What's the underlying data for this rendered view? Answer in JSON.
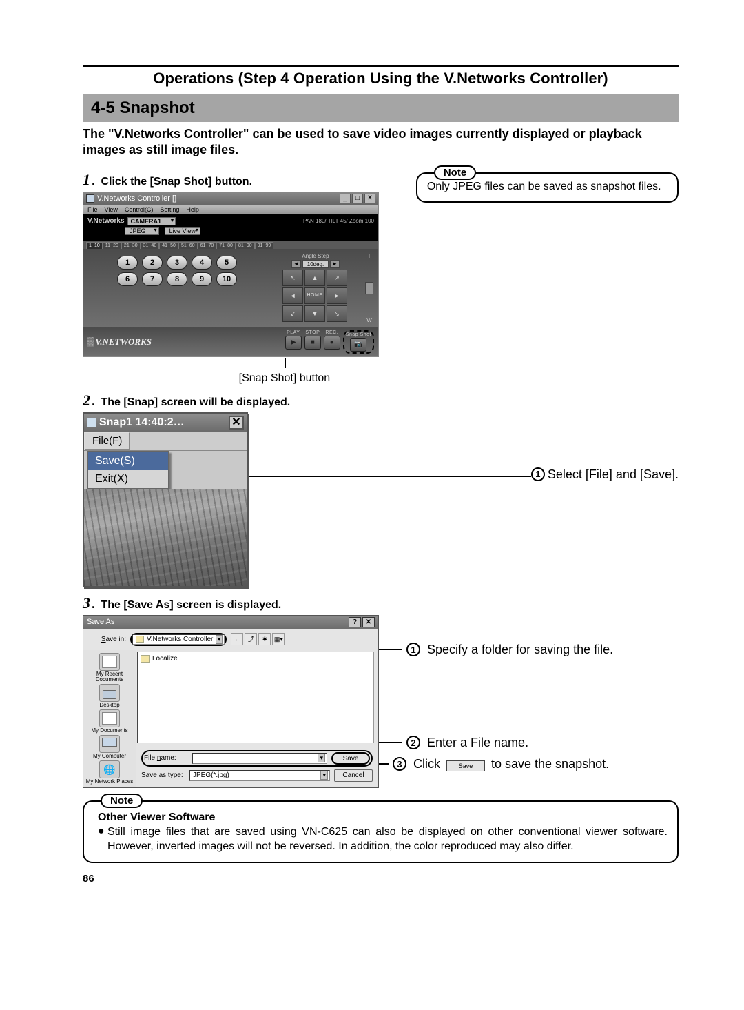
{
  "header": {
    "title": "Operations (Step 4 Operation Using the V.Networks Controller)"
  },
  "section": {
    "heading": "4-5 Snapshot",
    "intro": "The \"V.Networks Controller\" can be used to save video images currently displayed or playback images as still image files."
  },
  "note1": {
    "label": "Note",
    "body": "Only JPEG files can be saved as snapshot files."
  },
  "steps": {
    "s1": {
      "num": "1",
      "text": "Click the [Snap Shot] button."
    },
    "s2": {
      "num": "2",
      "text": "The [Snap] screen will be displayed."
    },
    "s3": {
      "num": "3",
      "text": "The [Save As] screen is displayed."
    }
  },
  "vn": {
    "title": "V.Networks Controller []",
    "menu": {
      "file": "File",
      "view": "View",
      "control": "Control(C)",
      "setting": "Setting",
      "help": "Help"
    },
    "brand": "V.Networks",
    "camera_label": "CAMERA1",
    "info": "PAN 180/ TILT 45/ Zoom 100",
    "jpeg": "JPEG",
    "live": "Live View",
    "tabs": [
      "1~10",
      "11~20",
      "21~30",
      "31~40",
      "41~50",
      "51~60",
      "61~70",
      "71~80",
      "81~90",
      "91~99"
    ],
    "presets": [
      "1",
      "2",
      "3",
      "4",
      "5",
      "6",
      "7",
      "8",
      "9",
      "10"
    ],
    "angle_step_label": "Angle Step",
    "angle_value": "10deg.",
    "home": "HOME",
    "rec": {
      "play": "PLAY",
      "stop": "STOP",
      "rec": "REC.",
      "snap": "Snap Shot"
    },
    "side": {
      "top": "T",
      "bottom": "W"
    },
    "logo": "V.NETWORKS"
  },
  "caption1": "[Snap Shot] button",
  "snap": {
    "title": "Snap1  14:40:2…",
    "file": "File(F)",
    "save": "Save(S)",
    "exit": "Exit(X)"
  },
  "anno1": {
    "n": "1",
    "text": "Select [File] and [Save]."
  },
  "saveas": {
    "title": "Save As",
    "savein_label": "Save in:",
    "savein_value": "V.Networks Controller",
    "folder": "Localize",
    "places": {
      "recent": "My Recent Documents",
      "desktop": "Desktop",
      "mydocs": "My Documents",
      "mycomp": "My Computer",
      "netplaces": "My Network Places"
    },
    "filename_label": "File name:",
    "filename_value": "",
    "type_label": "Save as type:",
    "type_value": "JPEG(*.jpg)",
    "save_btn": "Save",
    "cancel_btn": "Cancel"
  },
  "anno2": {
    "a": {
      "n": "1",
      "text": "Specify a folder for saving the file."
    },
    "b": {
      "n": "2",
      "text": "Enter a File name."
    },
    "c": {
      "n": "3",
      "pre": "Click ",
      "btn": "Save",
      "post": " to save the snapshot."
    }
  },
  "note2": {
    "label": "Note",
    "heading": "Other Viewer Software",
    "body": "Still image files that are saved using VN-C625 can also be displayed on other conventional viewer software. However, inverted images will not be reversed. In addition, the color reproduced may also differ."
  },
  "page_number": "86"
}
